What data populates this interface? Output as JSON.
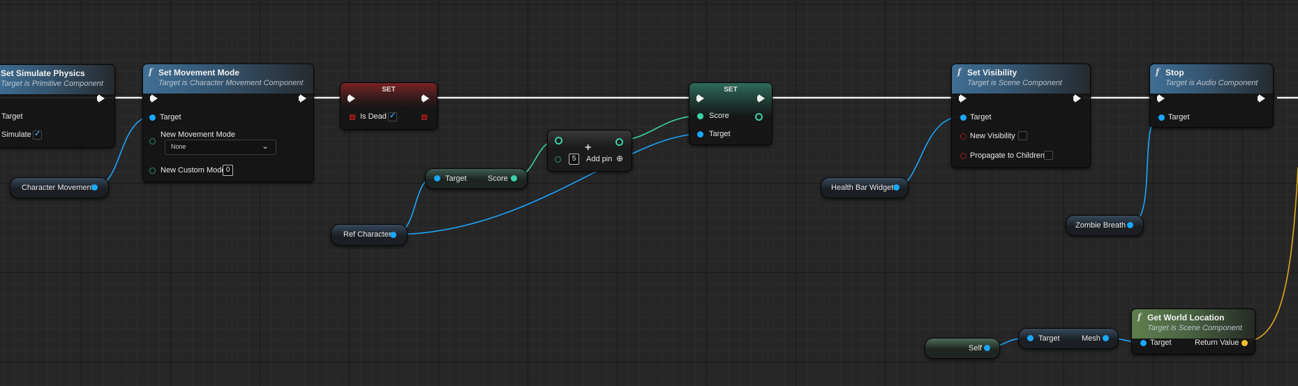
{
  "nodes": {
    "set_sim_physics": {
      "title": "Set Simulate Physics",
      "subtitle": "Target is Primitive Component",
      "target": "Target",
      "simulate": "Simulate",
      "simulate_checked": true
    },
    "set_movement_mode": {
      "icon": "f",
      "title": "Set Movement Mode",
      "subtitle": "Target is Character Movement Component",
      "target": "Target",
      "new_movement_mode": "New Movement Mode",
      "mode_value": "None",
      "new_custom_mode": "New Custom Mode",
      "custom_mode_value": "0"
    },
    "char_movement": {
      "label": "Character Movement"
    },
    "set_is_dead": {
      "title": "SET",
      "var": "Is Dead",
      "checked": true
    },
    "get_score": {
      "target": "Target",
      "score": "Score"
    },
    "add_node": {
      "plus": "+",
      "value": "5",
      "add_pin": "Add pin"
    },
    "set_score": {
      "title": "SET",
      "score": "Score",
      "target": "Target"
    },
    "ref_character": {
      "label": "Ref Character"
    },
    "set_visibility": {
      "icon": "f",
      "title": "Set Visibility",
      "subtitle": "Target is Scene Component",
      "target": "Target",
      "new_visibility": "New Visibility",
      "propagate": "Propagate to Children"
    },
    "health_bar": {
      "label": "Health Bar Widget"
    },
    "stop": {
      "icon": "f",
      "title": "Stop",
      "subtitle": "Target is Audio Component",
      "target": "Target"
    },
    "zombie_breath": {
      "label": "Zombie Breath"
    },
    "self": {
      "label": "Self"
    },
    "get_mesh": {
      "target": "Target",
      "mesh": "Mesh"
    },
    "get_world_location": {
      "icon": "f",
      "title": "Get World Location",
      "subtitle": "Target is Scene Component",
      "target": "Target",
      "return_value": "Return Value"
    }
  },
  "colors": {
    "background": "#262626",
    "object_pin": "#1aa7ff",
    "int_pin": "#3ad3a7",
    "bool_pin": "#9e1e1e",
    "vector_pin": "#f2c12a",
    "exec_wire": "#ffffff"
  }
}
